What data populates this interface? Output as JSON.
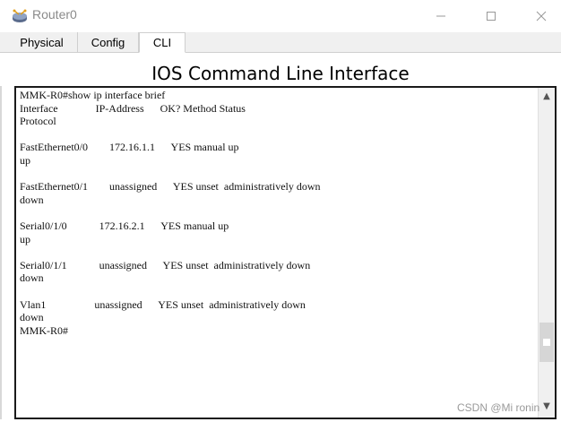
{
  "window": {
    "title": "Router0",
    "icon": "router-app-icon",
    "controls": [
      "minimize-icon",
      "maximize-icon",
      "close-icon"
    ]
  },
  "tabs": [
    {
      "label": "Physical",
      "active": false
    },
    {
      "label": "Config",
      "active": false
    },
    {
      "label": "CLI",
      "active": true
    }
  ],
  "heading": "IOS Command Line Interface",
  "terminal": {
    "lines": [
      "MMK-R0#show ip interface brief",
      "Interface              IP-Address      OK? Method Status",
      "Protocol",
      "",
      "FastEthernet0/0        172.16.1.1      YES manual up",
      "up",
      "",
      "FastEthernet0/1        unassigned      YES unset  administratively down",
      "down",
      "",
      "Serial0/1/0            172.16.2.1      YES manual up",
      "up",
      "",
      "Serial0/1/1            unassigned      YES unset  administratively down",
      "down",
      "",
      "Vlan1                  unassigned      YES unset  administratively down",
      "down",
      "MMK-R0#"
    ]
  },
  "watermark": "CSDN @Mi ronin",
  "colors": {
    "title_text": "#8a8a8a",
    "tab_bg": "#f0f0f0",
    "terminal_border": "#1a1a1a"
  }
}
